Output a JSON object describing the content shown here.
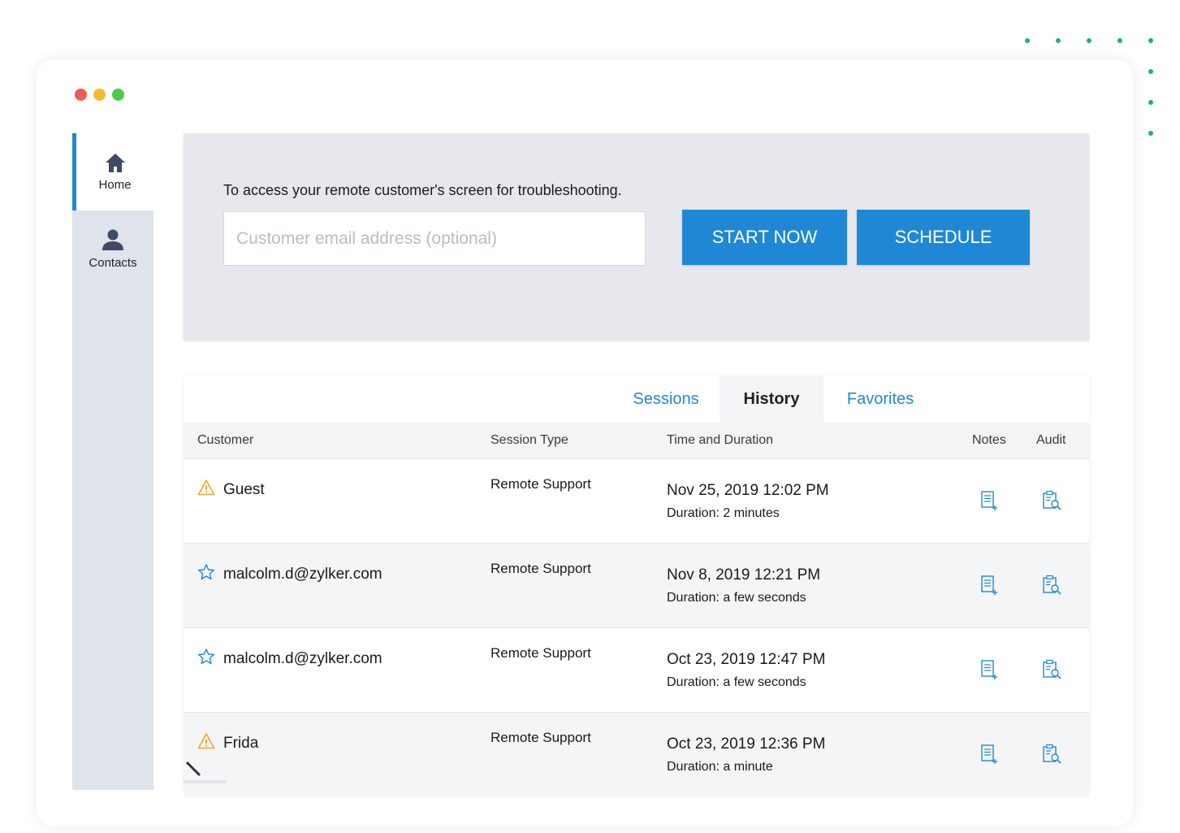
{
  "window": {
    "traffic_lights": {
      "close": "#ee5b54",
      "minimize": "#f4bb2e",
      "maximize": "#4ccb4a"
    }
  },
  "colors": {
    "accent": "#1e88d6",
    "dot_green": "#1db07a",
    "dot_light": "#8ddbb8",
    "warning": "#f0a428"
  },
  "sidebar": {
    "items": [
      {
        "label": "Home",
        "icon": "home-icon",
        "active": true
      },
      {
        "label": "Contacts",
        "icon": "contact-person-icon",
        "active": false
      }
    ]
  },
  "hero": {
    "description": "To access your remote customer's screen for troubleshooting.",
    "email_placeholder": "Customer email address (optional)",
    "start_label": "START NOW",
    "schedule_label": "SCHEDULE"
  },
  "tabs": [
    {
      "label": "Sessions",
      "active": false
    },
    {
      "label": "History",
      "active": true
    },
    {
      "label": "Favorites",
      "active": false
    }
  ],
  "table": {
    "columns": [
      "Customer",
      "Session Type",
      "Time and Duration",
      "Notes",
      "Audit"
    ],
    "rows": [
      {
        "icon": "warning-icon",
        "customer": "Guest",
        "session_type": "Remote Support",
        "time": "Nov 25, 2019 12:02 PM",
        "duration": "Duration: 2 minutes"
      },
      {
        "icon": "star-icon",
        "customer": "malcolm.d@zylker.com",
        "session_type": "Remote Support",
        "time": "Nov 8, 2019 12:21 PM",
        "duration": "Duration: a few seconds"
      },
      {
        "icon": "star-icon",
        "customer": "malcolm.d@zylker.com",
        "session_type": "Remote Support",
        "time": "Oct 23, 2019 12:47 PM",
        "duration": "Duration: a few seconds"
      },
      {
        "icon": "warning-icon",
        "customer": "Frida",
        "session_type": "Remote Support",
        "time": "Oct 23, 2019 12:36 PM",
        "duration": "Duration: a minute"
      }
    ]
  }
}
